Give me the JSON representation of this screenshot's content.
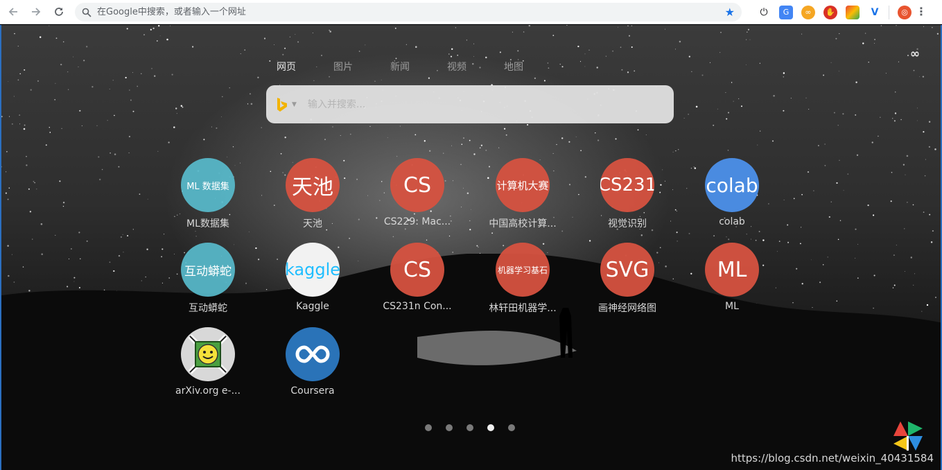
{
  "toolbar": {
    "address_placeholder": "在Google中搜索，或者输入一个网址",
    "extensions": [
      "power-icon",
      "translate-icon",
      "infinity-extension-icon",
      "adblock-icon",
      "color-picker-icon",
      "vimium-icon",
      "tampermonkey-icon"
    ]
  },
  "tabs": [
    {
      "label": "网页",
      "active": true
    },
    {
      "label": "图片",
      "active": false
    },
    {
      "label": "新闻",
      "active": false
    },
    {
      "label": "视频",
      "active": false
    },
    {
      "label": "地图",
      "active": false
    }
  ],
  "search": {
    "placeholder": "输入并搜索..."
  },
  "tiles": [
    {
      "icon_text": "ML 数据集",
      "label": "ML数据集",
      "color": "teal"
    },
    {
      "icon_text": "天池",
      "label": "天池",
      "color": "red"
    },
    {
      "icon_text": "CS",
      "label": "CS229: Mac...",
      "color": "red"
    },
    {
      "icon_text": "计算机大赛",
      "label": "中国高校计算...",
      "color": "red"
    },
    {
      "icon_text": "CS231",
      "label": "视觉识别",
      "color": "red"
    },
    {
      "icon_text": "colab",
      "label": "colab",
      "color": "blue"
    },
    {
      "icon_text": "互动蟒蛇",
      "label": "互动蟒蛇",
      "color": "teal"
    },
    {
      "icon_text": "kaggle",
      "label": "Kaggle",
      "color": "white"
    },
    {
      "icon_text": "CS",
      "label": "CS231n Con...",
      "color": "red"
    },
    {
      "icon_text": "机器学习基石",
      "label": "林轩田机器学...",
      "color": "red"
    },
    {
      "icon_text": "SVG",
      "label": "画神经网络图",
      "color": "red"
    },
    {
      "icon_text": "ML",
      "label": "ML",
      "color": "red"
    },
    {
      "icon_text": "",
      "label": "arXiv.org e-...",
      "color": "gray"
    },
    {
      "icon_text": "",
      "label": "Coursera",
      "color": "coursera"
    }
  ],
  "pagination": {
    "count": 5,
    "active_index": 3
  },
  "watermark": "https://blog.csdn.net/weixin_40431584"
}
